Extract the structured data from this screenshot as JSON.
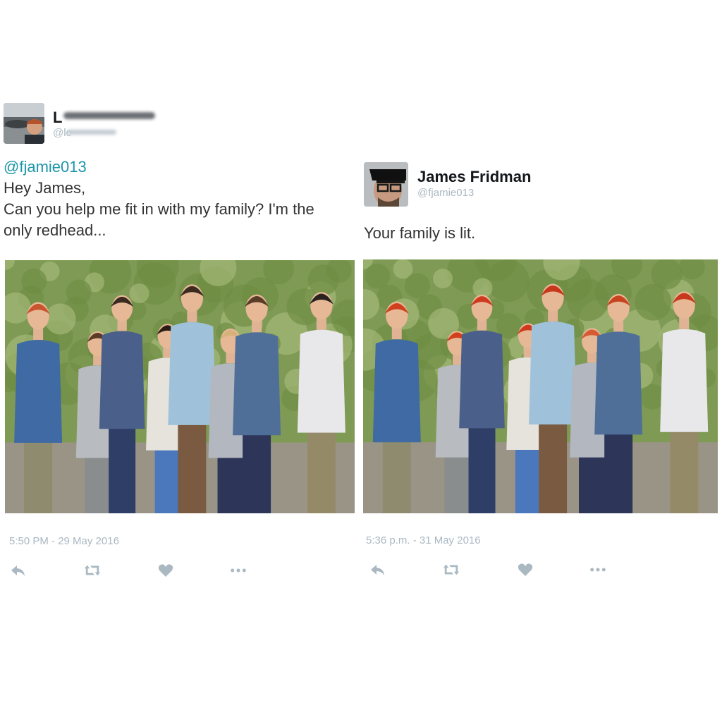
{
  "left_tweet": {
    "name_fragment": "L",
    "handle_fragment": "@lc",
    "mention": "@fjamie013",
    "text_lines": [
      "Hey James,",
      "Can you help me fit in with my family? I'm the",
      "only redhead..."
    ],
    "timestamp": "5:50 PM - 29 May 2016",
    "photo_hair_colors": [
      "#c9552f",
      "#5b3a26",
      "#3a2a20",
      "#2a1c14",
      "#3b2a1f",
      "#d6b27a",
      "#5a3c28",
      "#2b2320"
    ]
  },
  "right_tweet": {
    "name": "James Fridman",
    "handle": "@fjamie013",
    "text": "Your family is lit.",
    "timestamp": "5:36 p.m. - 31 May 2016",
    "photo_hair_colors": [
      "#d0401f",
      "#d0401f",
      "#cf3a1e",
      "#cf3a1e",
      "#c8361c",
      "#d65a34",
      "#c9431f",
      "#c7391c"
    ]
  },
  "action_icons": [
    "reply-icon",
    "retweet-icon",
    "like-icon",
    "more-icon"
  ],
  "colors": {
    "mention": "#1b95a8",
    "meta_gray": "#aab8c2",
    "icon_gray": "#aab8c2"
  }
}
